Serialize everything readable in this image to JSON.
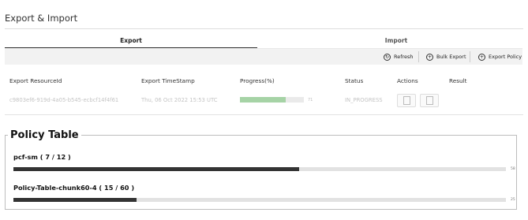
{
  "page": {
    "title": "Export & Import"
  },
  "tabs": [
    {
      "label": "Export",
      "active": true
    },
    {
      "label": "Import",
      "active": false
    }
  ],
  "toolbar": {
    "refresh_label": "Refresh",
    "bulk_export_label": "Bulk Export",
    "export_policy_label": "Export Policy"
  },
  "table": {
    "headers": [
      "Export ResourceId",
      "Export TimeStamp",
      "Progress(%)",
      "Status",
      "Actions",
      "Result"
    ],
    "row": {
      "resource_id": "c9803ef6-919d-4a05-b545-ecbcf14f4f61",
      "timestamp": "Thu, 06 Oct 2022 15:53 UTC",
      "progress": 71,
      "progress_text": "71",
      "status": "IN_PROGRESS"
    }
  },
  "policy_table": {
    "title": "Policy Table",
    "items": [
      {
        "label": "pcf-sm ( 7 / 12 )",
        "percent": 58,
        "value_text": "58"
      },
      {
        "label": "Policy-Table-chunk60-4 ( 15 / 60 )",
        "percent": 25,
        "value_text": "25"
      }
    ]
  },
  "colors": {
    "progress_green": "#a6d3a6",
    "bar_dark": "#333333",
    "toolbar_bg": "#f2f2f2"
  },
  "icons": {
    "refresh": "refresh-icon",
    "bulk_export": "plus-circle-icon",
    "export_policy": "plus-circle-icon"
  }
}
